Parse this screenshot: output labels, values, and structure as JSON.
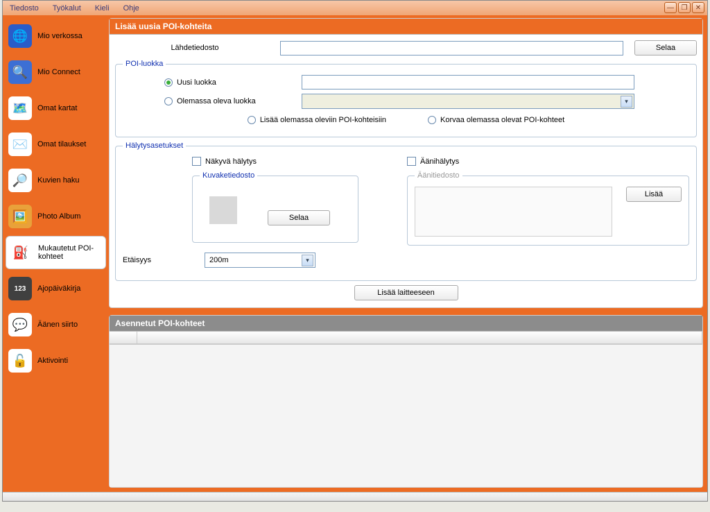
{
  "menu": {
    "file": "Tiedosto",
    "tools": "Työkalut",
    "lang": "Kieli",
    "help": "Ohje"
  },
  "sidebar": {
    "items": [
      {
        "label": "Mio verkossa",
        "icon": "🌐",
        "bg": "#2A5CC9"
      },
      {
        "label": "Mio Connect",
        "icon": "🔍",
        "bg": "#3C6FD4"
      },
      {
        "label": "Omat kartat",
        "icon": "🗺️",
        "bg": "#FFFFFF"
      },
      {
        "label": "Omat tilaukset",
        "icon": "✉️",
        "bg": "#FFFFFF"
      },
      {
        "label": "Kuvien haku",
        "icon": "🔎",
        "bg": "#FFFFFF"
      },
      {
        "label": "Photo Album",
        "icon": "🖼️",
        "bg": "#E9A13A"
      },
      {
        "label": "Mukautetut POI-kohteet",
        "icon": "⛽",
        "bg": "#FFFFFF"
      },
      {
        "label": "Ajopäiväkirja",
        "icon": "123",
        "bg": "#404040"
      },
      {
        "label": "Äänen siirto",
        "icon": "💬",
        "bg": "#FFFFFF"
      },
      {
        "label": "Aktivointi",
        "icon": "🔓",
        "bg": "#FFFFFF"
      }
    ],
    "selected_index": 6
  },
  "panel_add": {
    "title": "Lisää uusia POI-kohteita",
    "source_label": "Lähdetiedosto",
    "source_value": "",
    "browse": "Selaa",
    "group_class": {
      "legend": "POI-luokka",
      "new_class": "Uusi luokka",
      "existing_class": "Olemassa oleva luokka",
      "new_value": "",
      "add_existing": "Lisää olemassa oleviin POI-kohteisiin",
      "replace_existing": "Korvaa olemassa olevat POI-kohteet"
    },
    "group_alert": {
      "legend": "Hälytysasetukset",
      "visual": "Näkyvä hälytys",
      "audio": "Äänihälytys",
      "icon_file": "Kuvaketiedosto",
      "sound_file": "Äänitiedosto",
      "browse": "Selaa",
      "add": "Lisää",
      "distance_label": "Etäisyys",
      "distance_value": "200m"
    },
    "add_device": "Lisää laitteeseen"
  },
  "panel_installed": {
    "title": "Asennetut POI-kohteet"
  }
}
